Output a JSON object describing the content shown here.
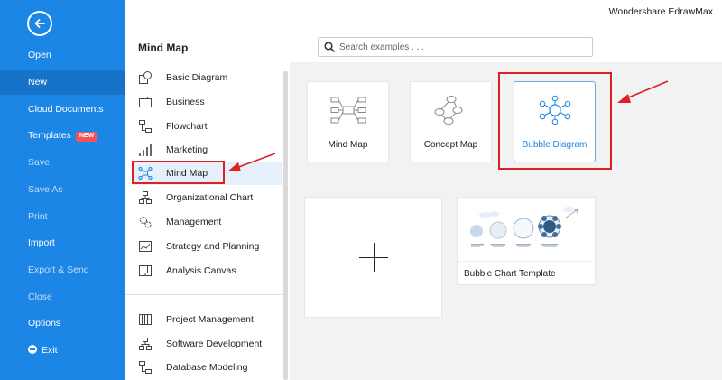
{
  "app": {
    "title": "Wondershare EdrawMax"
  },
  "nav": {
    "items": [
      {
        "label": "Open"
      },
      {
        "label": "New"
      },
      {
        "label": "Cloud Documents"
      },
      {
        "label": "Templates",
        "badge": "NEW"
      },
      {
        "label": "Save"
      },
      {
        "label": "Save As"
      },
      {
        "label": "Print"
      },
      {
        "label": "Import"
      },
      {
        "label": "Export & Send"
      },
      {
        "label": "Close"
      },
      {
        "label": "Options"
      },
      {
        "label": "Exit"
      }
    ],
    "active": "New"
  },
  "header": {
    "section_title": "Mind Map"
  },
  "search": {
    "placeholder": "Search examples . . ."
  },
  "categories": [
    {
      "label": "Basic Diagram",
      "icon": "shapes-icon"
    },
    {
      "label": "Business",
      "icon": "briefcase-icon"
    },
    {
      "label": "Flowchart",
      "icon": "flowchart-icon"
    },
    {
      "label": "Marketing",
      "icon": "bar-chart-icon"
    },
    {
      "label": "Mind Map",
      "icon": "mind-map-icon"
    },
    {
      "label": "Organizational Chart",
      "icon": "org-chart-icon"
    },
    {
      "label": "Management",
      "icon": "gears-icon"
    },
    {
      "label": "Strategy and Planning",
      "icon": "line-chart-icon"
    },
    {
      "label": "Analysis Canvas",
      "icon": "canvas-grid-icon"
    },
    {
      "label": "Project Management",
      "icon": "gantt-icon"
    },
    {
      "label": "Software Development",
      "icon": "software-diagram-icon"
    },
    {
      "label": "Database Modeling",
      "icon": "database-icon"
    }
  ],
  "selected_category": "Mind Map",
  "diagram_types": [
    {
      "label": "Mind Map",
      "icon": "mind-map-type-icon"
    },
    {
      "label": "Concept Map",
      "icon": "concept-map-type-icon"
    },
    {
      "label": "Bubble Diagram",
      "icon": "bubble-diagram-type-icon"
    }
  ],
  "selected_type": "Bubble Diagram",
  "templates": [
    {
      "label": "Bubble Chart Template"
    }
  ],
  "colors": {
    "nav_bg": "#1b86e6",
    "nav_active": "#1673c9",
    "accent": "#1b86e6",
    "badge": "#f0535a",
    "annotation_red": "#e02020"
  }
}
